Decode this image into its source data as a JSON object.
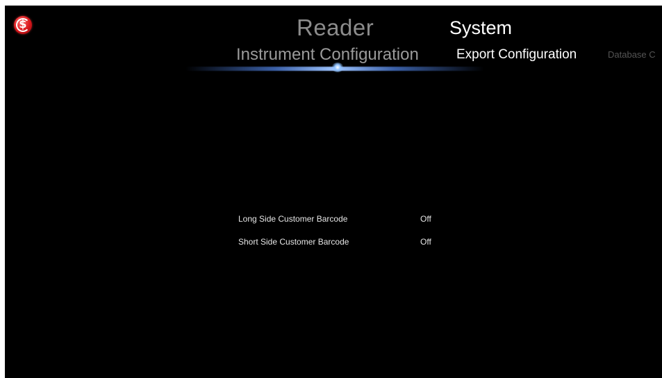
{
  "header": {
    "top_tabs": [
      {
        "label": "Reader"
      },
      {
        "label": "System"
      }
    ],
    "sub_tabs": [
      {
        "label": "Instrument Configuration"
      },
      {
        "label": "Export Configuration"
      },
      {
        "label": "Database C"
      }
    ]
  },
  "settings": [
    {
      "label": "Long Side Customer Barcode",
      "value": "Off"
    },
    {
      "label": "Short Side Customer Barcode",
      "value": "Off"
    }
  ],
  "colors": {
    "background": "#000000",
    "logo_red": "#d8161b",
    "active_text": "#ffffff",
    "inactive_text": "#8c8c8c",
    "glow_accent": "#9ec4ff"
  },
  "icons": {
    "logo": "app-logo-icon"
  }
}
